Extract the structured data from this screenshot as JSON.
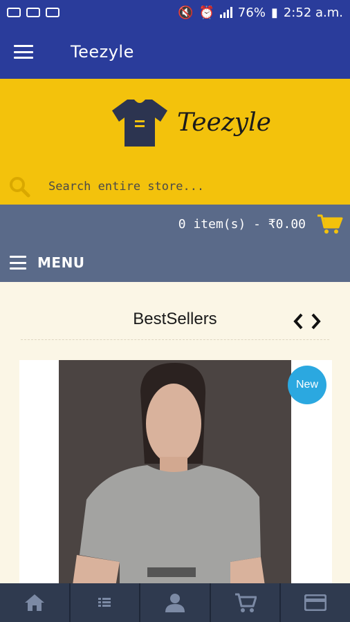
{
  "status_bar": {
    "battery": "76%",
    "time": "2:52 a.m."
  },
  "app_bar": {
    "title": "Teezyle"
  },
  "brand": {
    "logo_text": "Teezyle",
    "accent": "#f3c20c",
    "primary": "#2a3c9b"
  },
  "search": {
    "placeholder": "Search entire store..."
  },
  "cart": {
    "summary": "0 item(s) - ₹0.00"
  },
  "menu": {
    "label": "MENU"
  },
  "section": {
    "title": "BestSellers"
  },
  "product": {
    "badge": "New"
  },
  "bottom_nav": {
    "items": [
      "home-icon",
      "list-icon",
      "account-icon",
      "cart-icon",
      "card-icon"
    ]
  }
}
